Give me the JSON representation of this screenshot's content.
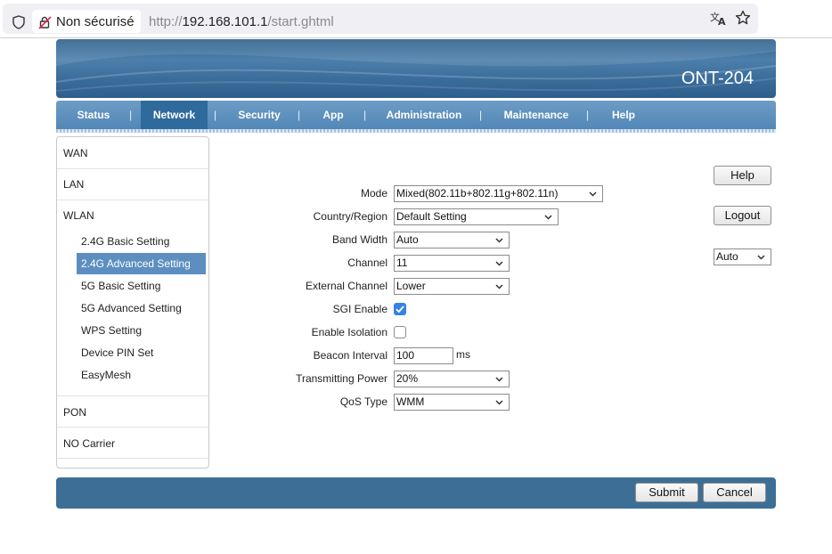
{
  "browser": {
    "security_label": "Non sécurisé",
    "url_scheme": "http://",
    "url_host": "192.168.101.1",
    "url_path": "/start.ghtml"
  },
  "header": {
    "model": "ONT-204"
  },
  "nav": {
    "items": [
      {
        "label": "Status"
      },
      {
        "label": "Network",
        "active": true
      },
      {
        "label": "Security"
      },
      {
        "label": "App"
      },
      {
        "label": "Administration"
      },
      {
        "label": "Maintenance"
      },
      {
        "label": "Help"
      }
    ],
    "separator": "|"
  },
  "sidebar": {
    "top": [
      "WAN",
      "LAN",
      "WLAN"
    ],
    "wlan_sub": [
      "2.4G Basic Setting",
      "2.4G Advanced Setting",
      "5G Basic Setting",
      "5G Advanced Setting",
      "WPS Setting",
      "Device PIN Set",
      "EasyMesh"
    ],
    "bottom": [
      "PON",
      "NO Carrier"
    ],
    "active_sub": "2.4G Advanced Setting"
  },
  "form": {
    "mode": {
      "label": "Mode",
      "value": "Mixed(802.11b+802.11g+802.11n)"
    },
    "country": {
      "label": "Country/Region",
      "value": "Default Setting"
    },
    "bandwidth": {
      "label": "Band Width",
      "value": "Auto"
    },
    "channel": {
      "label": "Channel",
      "value": "11"
    },
    "ext_channel": {
      "label": "External Channel",
      "value": "Lower"
    },
    "sgi": {
      "label": "SGI Enable",
      "checked": true
    },
    "isolation": {
      "label": "Enable Isolation",
      "checked": false
    },
    "beacon": {
      "label": "Beacon Interval",
      "value": "100",
      "unit": "ms"
    },
    "tx_power": {
      "label": "Transmitting Power",
      "value": "20%"
    },
    "qos": {
      "label": "QoS Type",
      "value": "WMM"
    }
  },
  "side_controls": {
    "help_label": "Help",
    "logout_label": "Logout",
    "refresh_value": "Auto"
  },
  "footer": {
    "submit_label": "Submit",
    "cancel_label": "Cancel"
  },
  "colors": {
    "accent": "#5287b6",
    "active_tab": "#2f6a9c",
    "sidebar_active": "#5c8fc0",
    "footer": "#3d6f96",
    "checkbox": "#3584e4"
  }
}
